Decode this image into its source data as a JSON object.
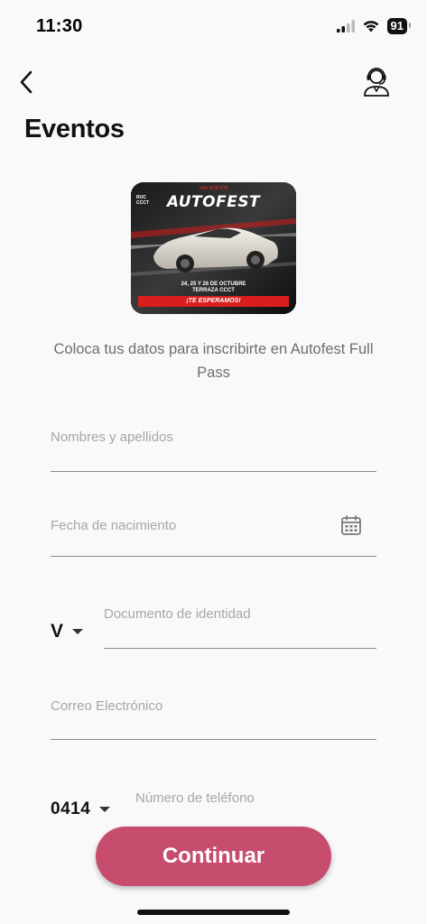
{
  "status": {
    "time": "11:30",
    "battery": "91"
  },
  "header": {
    "title": "Eventos"
  },
  "banner": {
    "edition": "10th EDICIÓN",
    "logo_text": "RUC\nCCCT",
    "title": "AUTOFEST",
    "dates": "24, 25 Y 26 DE OCTUBRE\nTERRAZA CCCT",
    "cta": "¡TE ESPERAMOS!"
  },
  "intro_text": "Coloca tus datos para inscribirte en Autofest Full Pass",
  "form": {
    "name_label": "Nombres y apellidos",
    "birthdate_label": "Fecha de nacimiento",
    "doc_type": "V",
    "document_label": "Documento de identidad",
    "email_label": "Correo Electrónico",
    "phone_code": "0414",
    "phone_label": "Número de teléfono"
  },
  "actions": {
    "continue_label": "Continuar"
  },
  "colors": {
    "accent": "#c74d6f",
    "background": "#f9f9f9"
  }
}
